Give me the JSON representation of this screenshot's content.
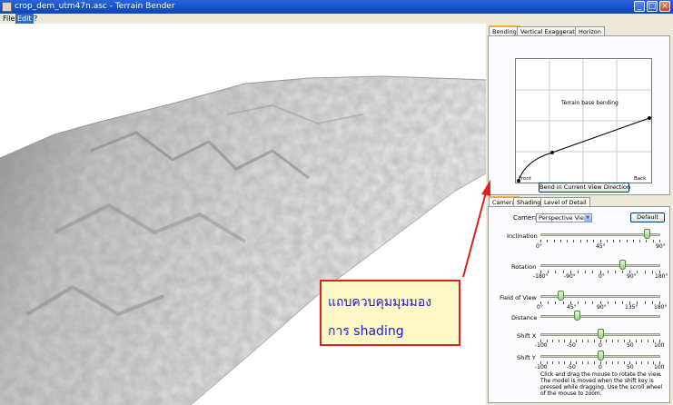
{
  "window": {
    "title": "crop_dem_utm47n.asc - Terrain Bender",
    "min_label": "_",
    "max_label": "□",
    "close_label": "×"
  },
  "menu": {
    "items": [
      "File",
      "Edit",
      "?"
    ]
  },
  "bending_tabs": [
    "Bending",
    "Vertical Exaggeration",
    "Horizon"
  ],
  "bending": {
    "caption": "Terrain base bending",
    "front_label": "Front",
    "back_label": "Back",
    "button_label": "Bend in Current View Direction"
  },
  "camera_tabs": [
    "Camera",
    "Shading",
    "Level of Detail"
  ],
  "camera": {
    "camera_label": "Camera",
    "camera_value": "Perspective View",
    "default_label": "Default",
    "inclination": {
      "label": "Inclination",
      "ticks": [
        "0°",
        "45°",
        "90°"
      ],
      "value": 80
    },
    "rotation": {
      "label": "Rotation",
      "ticks": [
        "-180°",
        "-90°",
        "0°",
        "90°",
        "180°"
      ],
      "value": 65
    },
    "fov": {
      "label": "Field of View",
      "ticks": [
        "0°",
        "45°",
        "90°",
        "135°",
        "180°"
      ],
      "value": 30
    },
    "distance": {
      "label": "Distance",
      "ticks": []
    },
    "shiftx": {
      "label": "Shift X",
      "ticks": [
        "-100",
        "-50",
        "0",
        "50",
        "100"
      ],
      "value": 0
    },
    "shifty": {
      "label": "Shift Y",
      "ticks": [
        "-100",
        "-50",
        "0",
        "50",
        "100"
      ],
      "value": 0
    },
    "help": "Click and drag the mouse to rotate the view. The model is moved when the shift key is pressed while dragging. Use the scroll wheel of the mouse to zoom."
  },
  "annotation": {
    "line1": "แถบควบคุมมุมมอง",
    "line2": "การ shading",
    "border_color": "#e0201c",
    "text_color": "#1a1ad8"
  }
}
